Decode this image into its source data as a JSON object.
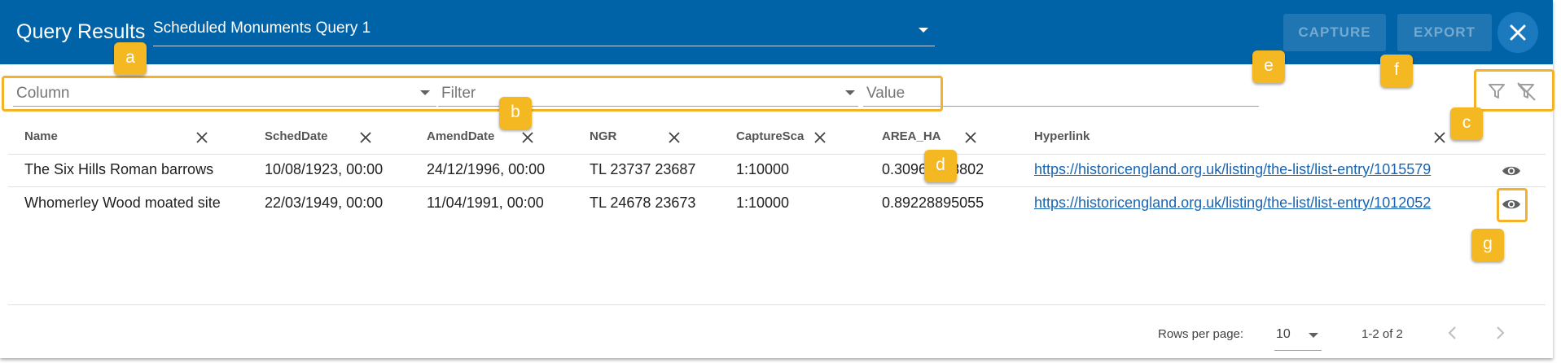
{
  "header": {
    "title": "Query Results",
    "query": "Scheduled Monuments Query 1",
    "capture_label": "CAPTURE",
    "export_label": "EXPORT",
    "close_icon": "close-icon"
  },
  "filter_bar": {
    "column_placeholder": "Column",
    "filter_placeholder": "Filter",
    "value_placeholder": "Value",
    "filter_icon": "filter-icon",
    "clear_filter_icon": "filter-off-icon"
  },
  "table": {
    "columns": [
      "Name",
      "SchedDate",
      "AmendDate",
      "NGR",
      "CaptureSca",
      "AREA_HA",
      "Hyperlink"
    ],
    "rows": [
      {
        "name": "The Six Hills Roman barrows",
        "sched_date": "10/08/1923, 00:00",
        "amend_date": "24/12/1996, 00:00",
        "ngr": "TL 23737 23687",
        "capture_scale": "1:10000",
        "area_ha": "0.30968478802",
        "hyperlink": "https://historicengland.org.uk/listing/the-list/list-entry/1015579"
      },
      {
        "name": "Whomerley Wood moated site",
        "sched_date": "22/03/1949, 00:00",
        "amend_date": "11/04/1991, 00:00",
        "ngr": "TL 24678 23673",
        "capture_scale": "1:10000",
        "area_ha": "0.89228895055",
        "hyperlink": "https://historicengland.org.uk/listing/the-list/list-entry/1012052"
      }
    ]
  },
  "footer": {
    "rows_per_page_label": "Rows per page:",
    "rows_per_page_value": "10",
    "range": "1-2 of 2"
  },
  "annotations": [
    "a",
    "b",
    "c",
    "d",
    "e",
    "f",
    "g"
  ],
  "colors": {
    "header_bg": "#0063a8",
    "annotation": "#f4b823",
    "link": "#1765b4"
  }
}
